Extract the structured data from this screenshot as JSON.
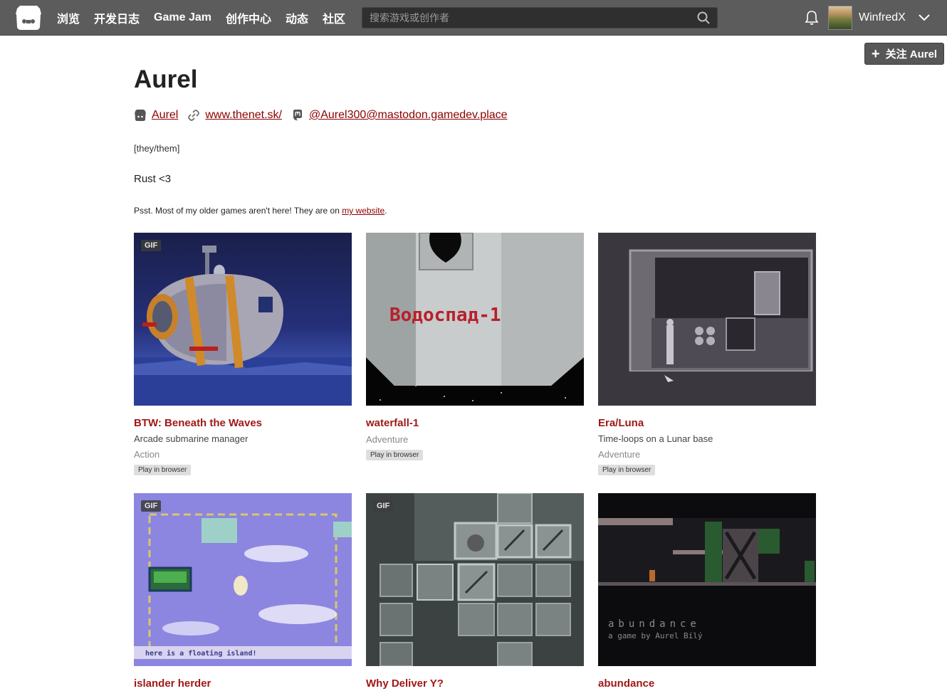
{
  "nav": {
    "items": [
      {
        "label": "浏览"
      },
      {
        "label": "开发日志"
      },
      {
        "label": "Game Jam"
      },
      {
        "label": "创作中心"
      },
      {
        "label": "动态"
      },
      {
        "label": "社区"
      }
    ],
    "search_placeholder": "搜索游戏或创作者",
    "username": "WinfredX"
  },
  "profile": {
    "follow_label": "关注 Aurel",
    "name": "Aurel",
    "itch_link": "Aurel",
    "website_link": "www.thenet.sk/",
    "mastodon_link": "@Aurel300@mastodon.gamedev.place",
    "pronouns": "[they/them]",
    "tagline": "Rust <3",
    "note_prefix": "Psst. Most of my older games aren't here! They are on ",
    "note_link": "my website",
    "note_suffix": "."
  },
  "games": [
    {
      "title": "BTW: Beneath the Waves",
      "description": "Arcade submarine manager",
      "genre": "Action",
      "badge": "Play in browser",
      "gif": "GIF",
      "thumb_text": ""
    },
    {
      "title": "waterfall-1",
      "description": "",
      "genre": "Adventure",
      "badge": "Play in browser",
      "gif": "",
      "thumb_text": "Водоспад-1"
    },
    {
      "title": "Era/Luna",
      "description": "Time-loops on a Lunar base",
      "genre": "Adventure",
      "badge": "Play in browser",
      "gif": "",
      "thumb_text": ""
    },
    {
      "title": "islander herder",
      "description": "",
      "genre": "",
      "badge": "",
      "gif": "GIF",
      "thumb_text": "here is a floating island!"
    },
    {
      "title": "Why Deliver Y?",
      "description": "",
      "genre": "",
      "badge": "",
      "gif": "GIF",
      "thumb_text": ""
    },
    {
      "title": "abundance",
      "description": "",
      "genre": "",
      "badge": "",
      "gif": "",
      "thumb_text": "abundance",
      "thumb_subtext": "a game by Aurel Bílý"
    }
  ],
  "colors": {
    "topbar": "#5c5c5c",
    "link": "#8b0000",
    "game_title": "#a01818"
  }
}
